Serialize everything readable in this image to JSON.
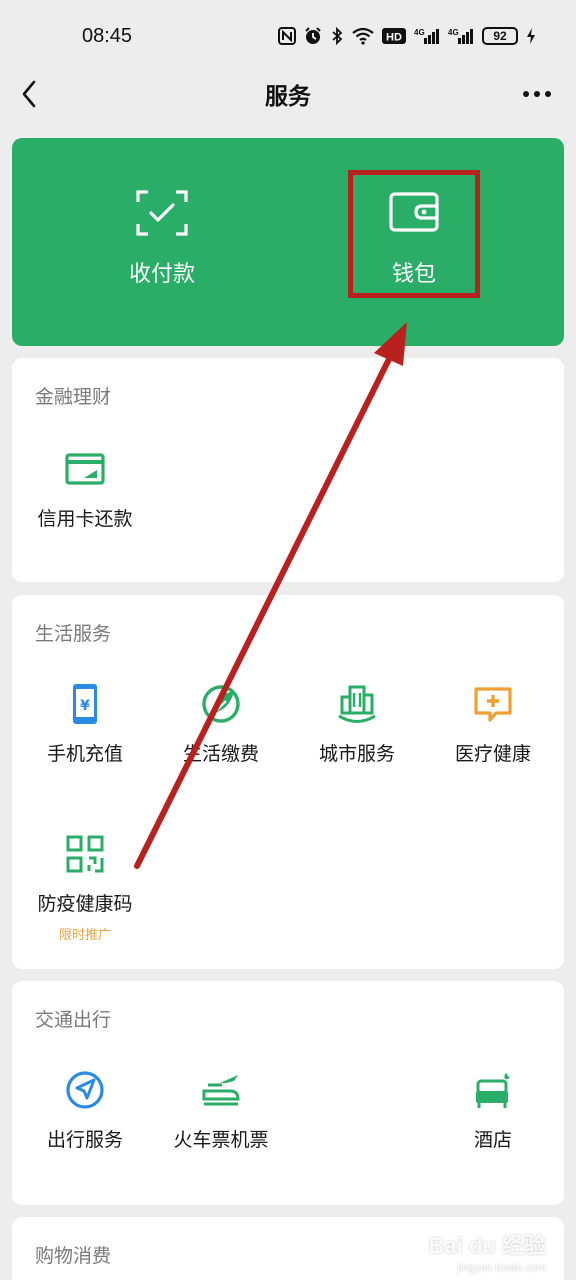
{
  "status_bar": {
    "time": "08:45",
    "battery": "92",
    "icons": [
      "nfc-icon",
      "alarm-icon",
      "bluetooth-icon",
      "wifi-icon",
      "hd-icon",
      "signal-4g-icon",
      "signal-4g-icon",
      "battery-icon",
      "charging-icon"
    ],
    "hd_label": "HD",
    "net_label": "4G"
  },
  "header": {
    "title": "服务",
    "back_icon": "chevron-left-icon",
    "more_icon": "more-dots-icon"
  },
  "pay_card": {
    "color": "#2aae67",
    "items": [
      {
        "label": "收付款",
        "icon": "scan-check-icon"
      },
      {
        "label": "钱包",
        "icon": "wallet-icon"
      }
    ]
  },
  "sections": {
    "finance": {
      "title": "金融理财",
      "items": [
        {
          "label": "信用卡还款",
          "icon": "credit-card-icon"
        }
      ]
    },
    "life": {
      "title": "生活服务",
      "items": [
        {
          "label": "手机充值",
          "icon": "phone-topup-icon"
        },
        {
          "label": "生活缴费",
          "icon": "leaf-icon"
        },
        {
          "label": "城市服务",
          "icon": "city-icon"
        },
        {
          "label": "医疗健康",
          "icon": "medical-icon"
        },
        {
          "label": "防疫健康码",
          "icon": "qr-code-icon",
          "sub": "限时推广"
        }
      ]
    },
    "transport": {
      "title": "交通出行",
      "items": [
        {
          "label": "出行服务",
          "icon": "navigation-icon"
        },
        {
          "label": "火车票机票",
          "icon": "train-plane-icon"
        },
        {
          "label": "酒店",
          "icon": "hotel-bed-icon"
        }
      ]
    },
    "shopping": {
      "title": "购物消费"
    }
  },
  "annotation": {
    "color": "#b8211e"
  },
  "watermark": {
    "brand": "Bai du 经验",
    "url": "jingyan.baidu.com"
  },
  "colors": {
    "green": "#2aae67",
    "blue": "#2b8ae6",
    "orange": "#f0a030",
    "promo": "#e5a544",
    "background": "#ededed"
  }
}
